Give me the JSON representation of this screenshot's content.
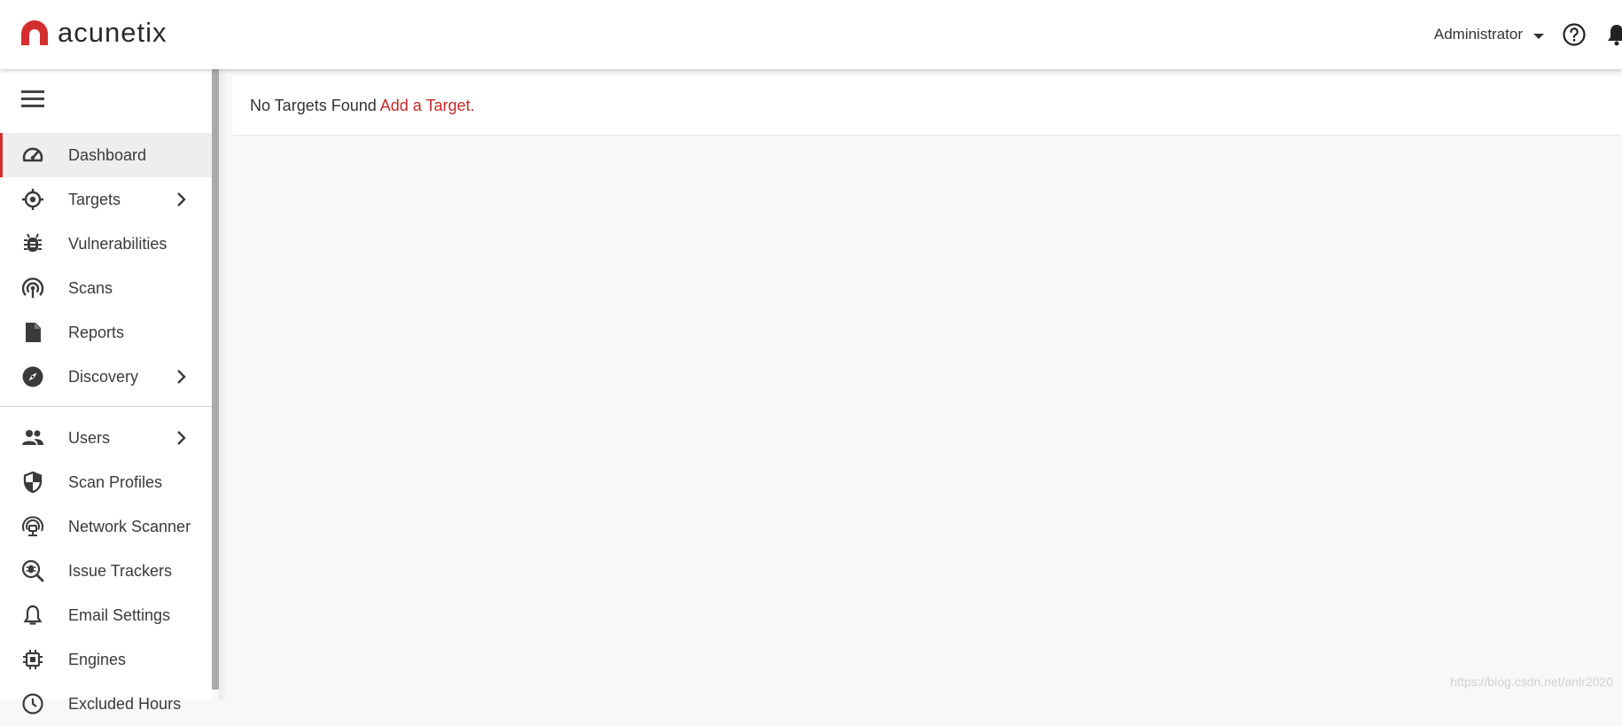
{
  "header": {
    "brand": "acunetix",
    "user_name": "Administrator",
    "icons": {
      "help": "help-circle-icon",
      "notifications": "bell-icon",
      "menu": "caret-down-icon"
    },
    "colors": {
      "brand_red": "#d32f2f"
    }
  },
  "sidebar": {
    "menu_icon": "hamburger-icon",
    "items": [
      {
        "label": "Dashboard",
        "icon": "speedometer-icon",
        "active": true,
        "has_submenu": false
      },
      {
        "label": "Targets",
        "icon": "crosshair-icon",
        "has_submenu": true
      },
      {
        "label": "Vulnerabilities",
        "icon": "bug-icon",
        "has_submenu": false
      },
      {
        "label": "Scans",
        "icon": "radar-icon",
        "has_submenu": false
      },
      {
        "label": "Reports",
        "icon": "document-icon",
        "has_submenu": false
      },
      {
        "label": "Discovery",
        "icon": "compass-icon",
        "has_submenu": true
      }
    ],
    "settings_items": [
      {
        "label": "Users",
        "icon": "users-icon",
        "has_submenu": true
      },
      {
        "label": "Scan Profiles",
        "icon": "shield-icon",
        "has_submenu": false
      },
      {
        "label": "Network Scanner",
        "icon": "network-scanner-icon",
        "has_submenu": false
      },
      {
        "label": "Issue Trackers",
        "icon": "bug-search-icon",
        "has_submenu": false
      },
      {
        "label": "Email Settings",
        "icon": "bell-outline-icon",
        "has_submenu": false
      },
      {
        "label": "Engines",
        "icon": "chip-icon",
        "has_submenu": false
      },
      {
        "label": "Excluded Hours",
        "icon": "clock-icon",
        "has_submenu": false
      }
    ]
  },
  "main": {
    "notice_text": "No Targets Found",
    "notice_link": "Add a Target."
  },
  "watermark": "https://blog.csdn.net/anlr2020"
}
